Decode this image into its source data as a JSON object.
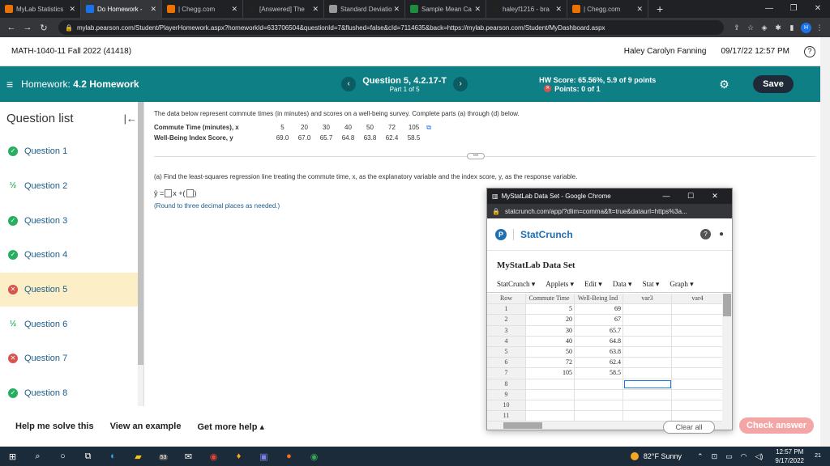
{
  "browser": {
    "tabs": [
      {
        "label": "MyLab Statistics",
        "icon": "mylab-icon",
        "color": "#e8710a"
      },
      {
        "label": "Do Homework -",
        "icon": "pearson-icon",
        "color": "#1a73e8"
      },
      {
        "label": "| Chegg.com",
        "icon": "chegg-icon",
        "color": "#eb7100"
      },
      {
        "label": "[Answered] The",
        "icon": "bartleby-icon",
        "color": "#222"
      },
      {
        "label": "Standard Deviatio",
        "icon": "calculator-icon",
        "color": "#999"
      },
      {
        "label": "Sample Mean Ca",
        "icon": "calc-green-icon",
        "color": "#1e8e3e"
      },
      {
        "label": "haleyf1216 - bra",
        "icon": "brainly-icon",
        "color": "#222"
      },
      {
        "label": "| Chegg.com",
        "icon": "chegg-icon",
        "color": "#eb7100"
      }
    ],
    "url": "mylab.pearson.com/Student/PlayerHomework.aspx?homeworkId=633706504&questionId=7&flushed=false&cId=7114635&back=https://mylab.pearson.com/Student/MyDashboard.aspx",
    "profile_initial": "H"
  },
  "course": {
    "title": "MATH-1040-11 Fall 2022 (41418)",
    "user": "Haley Carolyn Fanning",
    "datetime": "09/17/22 12:57 PM"
  },
  "hw": {
    "label": "Homework:",
    "name": "4.2 Homework",
    "question": "Question 5, 4.2.17-T",
    "part": "Part 1 of 5",
    "score": "HW Score: 65.56%, 5.9 of 9 points",
    "points": "Points: 0 of 1",
    "save": "Save"
  },
  "question_list": {
    "title": "Question list",
    "items": [
      {
        "label": "Question 1",
        "status": "done"
      },
      {
        "label": "Question 2",
        "status": "partial"
      },
      {
        "label": "Question 3",
        "status": "done"
      },
      {
        "label": "Question 4",
        "status": "done"
      },
      {
        "label": "Question 5",
        "status": "wrong"
      },
      {
        "label": "Question 6",
        "status": "partial"
      },
      {
        "label": "Question 7",
        "status": "wrong"
      },
      {
        "label": "Question 8",
        "status": "done"
      }
    ]
  },
  "question": {
    "intro": "The data below represent commute times (in minutes) and scores on a well-being survey. Complete parts (a) through (d) below.",
    "row_x_label": "Commute Time (minutes), x",
    "row_x": [
      "5",
      "20",
      "30",
      "40",
      "50",
      "72",
      "105"
    ],
    "row_y_label": "Well-Being Index Score, y",
    "row_y": [
      "69.0",
      "67.0",
      "65.7",
      "64.8",
      "63.8",
      "62.4",
      "58.5"
    ],
    "part_a": "(a) Find the least-squares regression line treating the commute time, x, as the explanatory variable and the index score, y, as the response variable.",
    "formula_lhs": "ŷ =",
    "formula_mid": "x +",
    "round_note": "(Round to three decimal places as needed.)"
  },
  "popup": {
    "window_title": "MyStatLab Data Set - Google Chrome",
    "url": "statcrunch.com/app/?dlim=comma&ft=true&dataurl=https%3a...",
    "brand": "StatCrunch",
    "dataset_title": "MyStatLab Data Set",
    "menu": [
      "StatCrunch ▾",
      "Applets ▾",
      "Edit ▾",
      "Data ▾",
      "Stat ▾",
      "Graph ▾"
    ],
    "columns": [
      "Row",
      "Commute Time",
      "Well-Being Ind",
      "var3",
      "var4"
    ],
    "rows": [
      [
        "1",
        "5",
        "69",
        "",
        ""
      ],
      [
        "2",
        "20",
        "67",
        "",
        ""
      ],
      [
        "3",
        "30",
        "65.7",
        "",
        ""
      ],
      [
        "4",
        "40",
        "64.8",
        "",
        ""
      ],
      [
        "5",
        "50",
        "63.8",
        "",
        ""
      ],
      [
        "6",
        "72",
        "62.4",
        "",
        ""
      ],
      [
        "7",
        "105",
        "58.5",
        "",
        ""
      ],
      [
        "8",
        "",
        "",
        "",
        ""
      ],
      [
        "9",
        "",
        "",
        "",
        ""
      ],
      [
        "10",
        "",
        "",
        "",
        ""
      ],
      [
        "11",
        "",
        "",
        "",
        ""
      ]
    ]
  },
  "bottom": {
    "help": "Help me solve this",
    "example": "View an example",
    "more_help": "Get more help ▴",
    "clear_all": "Clear all",
    "check": "Check answer"
  },
  "taskbar": {
    "weather": "82°F Sunny",
    "time": "12:57 PM",
    "date": "9/17/2022",
    "badge": "53",
    "notif_count": "21"
  }
}
